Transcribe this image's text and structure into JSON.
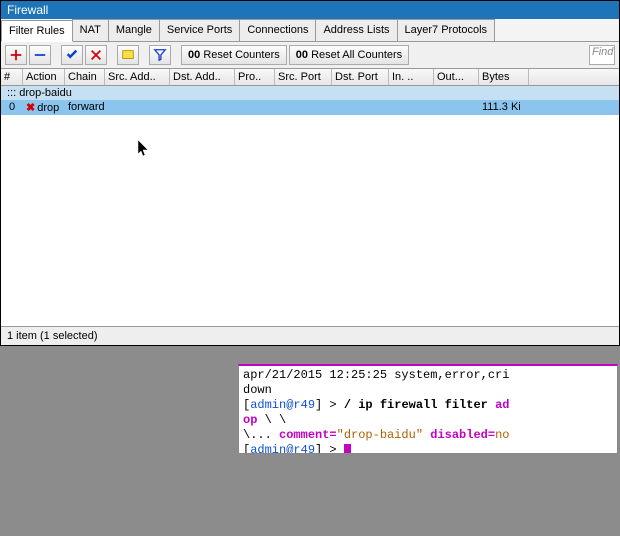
{
  "window": {
    "title": "Firewall"
  },
  "tabs": [
    "Filter Rules",
    "NAT",
    "Mangle",
    "Service Ports",
    "Connections",
    "Address Lists",
    "Layer7 Protocols"
  ],
  "activeTab": 0,
  "toolbar": {
    "reset_counters": "Reset Counters",
    "reset_all_counters": "Reset All Counters",
    "find_placeholder": "Find"
  },
  "columns": [
    "#",
    "Action",
    "Chain",
    "Src. Add..",
    "Dst. Add..",
    "Pro..",
    "Src. Port",
    "Dst. Port",
    "In. ..",
    "Out...",
    "Bytes"
  ],
  "group_label": "::: drop-baidu",
  "row": {
    "num": "0",
    "action": "drop",
    "chain": "forward",
    "bytes": "111.3 Ki"
  },
  "status": "1 item (1 selected)",
  "terminal": {
    "l0a": "apr/21/2015 12:25:25 system,error,cri",
    "l1": "down",
    "prompt_open": "[",
    "prompt_user": "admin@r49",
    "prompt_close": "] > ",
    "cmd1_a": "/ ip firewall filter ",
    "cmd1_b": "ad",
    "cmd2_a": "op ",
    "cmd2_b": "\\ \\",
    "cmd3_a": "\\... ",
    "cmd3_key1": "comment=",
    "cmd3_val1": "\"drop-baidu\"",
    "cmd3_key2": " disabled=",
    "cmd3_val2": "no"
  }
}
